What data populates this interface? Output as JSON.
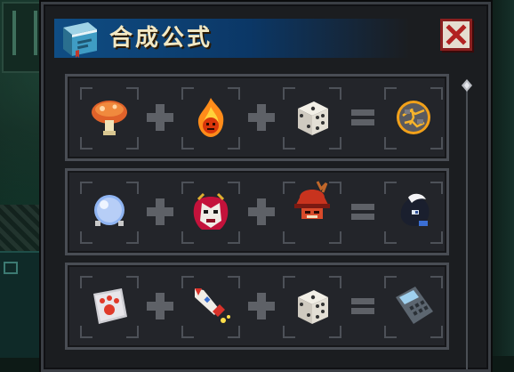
{
  "window": {
    "title": "合成公式",
    "title_icon": "book-icon",
    "close_icon": "close-icon"
  },
  "operators": {
    "plus": "plus-icon",
    "equals": "equals-icon"
  },
  "recipes": [
    {
      "ingredients": [
        "mushroom-icon",
        "fire-spirit-icon",
        "dice-icon"
      ],
      "result": "magma-orb-icon"
    },
    {
      "ingredients": [
        "crystal-orb-icon",
        "demon-mask-icon",
        "samurai-helmet-icon"
      ],
      "result": "hooded-spirit-icon"
    },
    {
      "ingredients": [
        "paw-print-card-icon",
        "rocket-icon",
        "dice-icon"
      ],
      "result": "calculator-icon"
    }
  ],
  "colors": {
    "title_bar": "#0f4d84",
    "title_text": "#f3e9c4",
    "close_border": "#8a1f1f",
    "row_bg": "#23252a",
    "operator": "#5e6167"
  }
}
